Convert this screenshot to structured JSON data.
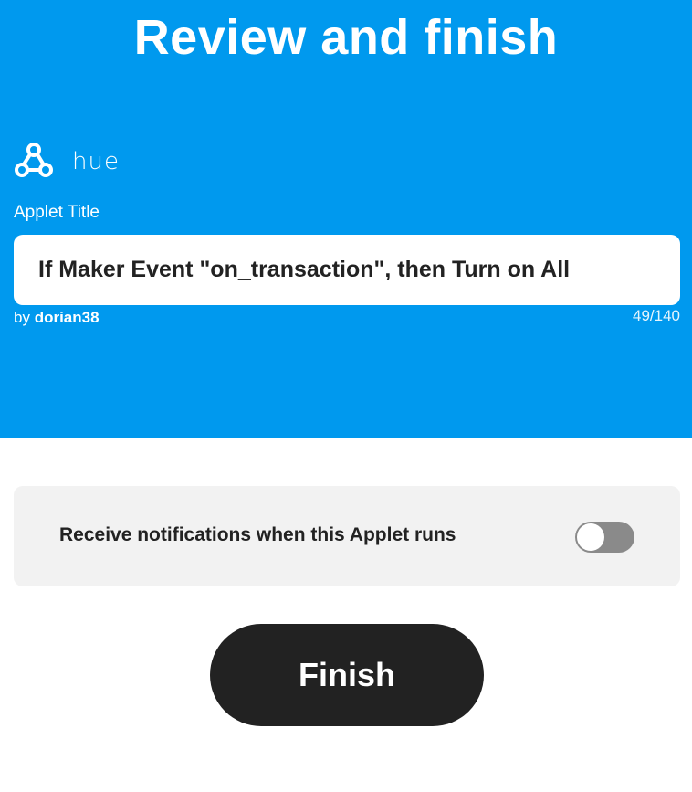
{
  "header": {
    "title": "Review and finish"
  },
  "service": {
    "icon": "webhook-icon",
    "brand": "hue"
  },
  "applet": {
    "title_label": "Applet Title",
    "title_value": "If Maker Event \"on_transaction\", then Turn on All",
    "by_prefix": "by",
    "author": "dorian38",
    "char_count": "49/140"
  },
  "notifications": {
    "label": "Receive notifications when this Applet runs",
    "enabled": false
  },
  "actions": {
    "finish_label": "Finish"
  },
  "colors": {
    "primary_blue": "#0099ee",
    "card_background": "#f2f2f2",
    "button_dark": "#222222",
    "toggle_off": "#8a8a8a"
  }
}
